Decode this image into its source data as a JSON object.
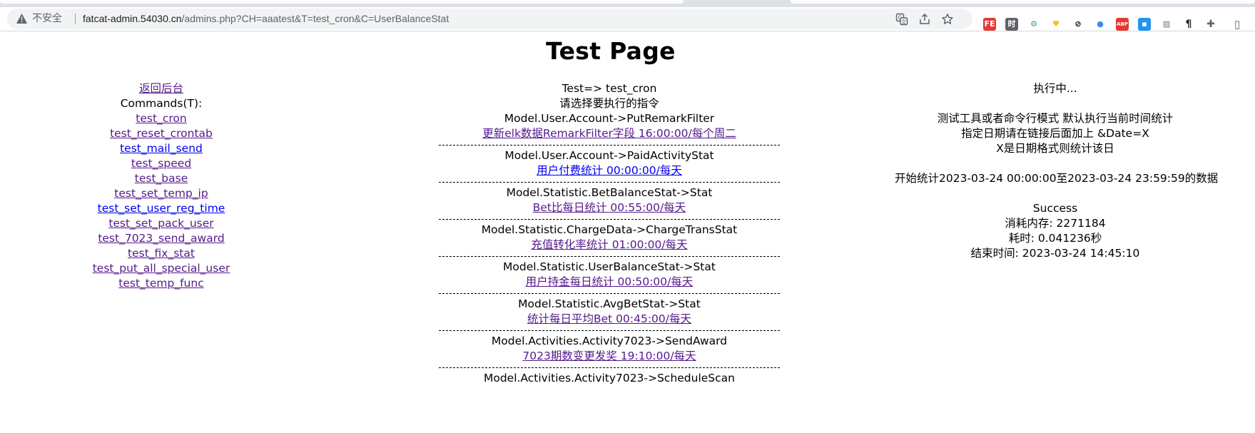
{
  "browser": {
    "security_label": "不安全",
    "url_host": "fatcat-admin.54030.cn",
    "url_path": "/admins.php?CH=aaatest&T=test_cron&C=UserBalanceStat",
    "extensions": [
      {
        "name": "fe-extension-icon",
        "label": "FE",
        "bg": "#e53935",
        "fg": "#ffffff"
      },
      {
        "name": "time-extension-icon",
        "label": "时",
        "bg": "#5f6368",
        "fg": "#ffffff"
      },
      {
        "name": "green-gear-extension-icon",
        "label": "⚙",
        "bg": "#ffffff",
        "fg": "#34a853"
      },
      {
        "name": "heart-extension-icon",
        "label": "♥",
        "bg": "#ffffff",
        "fg": "#fbbc04"
      },
      {
        "name": "block-extension-icon",
        "label": "⊘",
        "bg": "#ffffff",
        "fg": "#000000"
      },
      {
        "name": "blue-dot-extension-icon",
        "label": "●",
        "bg": "#ffffff",
        "fg": "#4285f4"
      },
      {
        "name": "adblock-extension-icon",
        "label": "ABP",
        "bg": "#e53935",
        "fg": "#ffffff"
      },
      {
        "name": "blue-square-extension-icon",
        "label": "▪",
        "bg": "#2196f3",
        "fg": "#ffffff"
      },
      {
        "name": "image-extension-icon",
        "label": "▨",
        "bg": "#ffffff",
        "fg": "#8d6e63"
      },
      {
        "name": "pilcrow-extension-icon",
        "label": "¶",
        "bg": "#ffffff",
        "fg": "#202124"
      },
      {
        "name": "puzzle-extensions-icon",
        "label": "✚",
        "bg": "#ffffff",
        "fg": "#5f6368"
      },
      {
        "name": "sidepanel-icon",
        "label": "▯",
        "bg": "#ffffff",
        "fg": "#5f6368"
      }
    ]
  },
  "page": {
    "title": "Test Page"
  },
  "left": {
    "back_link": "返回后台",
    "commands_label": "Commands(T):",
    "commands": [
      {
        "label": "test_cron",
        "visited": true
      },
      {
        "label": "test_reset_crontab",
        "visited": true
      },
      {
        "label": "test_mail_send",
        "visited": false
      },
      {
        "label": "test_speed",
        "visited": true
      },
      {
        "label": "test_base",
        "visited": true
      },
      {
        "label": "test_set_temp_ip",
        "visited": true
      },
      {
        "label": "test_set_user_reg_time",
        "visited": false
      },
      {
        "label": "test_set_pack_user",
        "visited": true
      },
      {
        "label": "test_7023_send_award",
        "visited": true
      },
      {
        "label": "test_fix_stat",
        "visited": true
      },
      {
        "label": "test_put_all_special_user",
        "visited": true
      },
      {
        "label": "test_temp_func",
        "visited": true
      }
    ]
  },
  "middle": {
    "header": "Test=> test_cron",
    "prompt": "请选择要执行的指令",
    "jobs": [
      {
        "model": "Model.User.Account->PutRemarkFilter",
        "link": "更新elk数据RemarkFilter字段 16:00:00/每个周二",
        "visited": true
      },
      {
        "model": "Model.User.Account->PaidActivityStat",
        "link": "用户付费统计 00:00:00/每天",
        "visited": false
      },
      {
        "model": "Model.Statistic.BetBalanceStat->Stat",
        "link": "Bet比每日统计 00:55:00/每天",
        "visited": true
      },
      {
        "model": "Model.Statistic.ChargeData->ChargeTransStat",
        "link": "充值转化率统计 01:00:00/每天",
        "visited": true
      },
      {
        "model": "Model.Statistic.UserBalanceStat->Stat",
        "link": "用户持金每日统计 00:50:00/每天",
        "visited": true
      },
      {
        "model": "Model.Statistic.AvgBetStat->Stat",
        "link": "统计每日平均Bet 00:45:00/每天",
        "visited": true
      },
      {
        "model": "Model.Activities.Activity7023->SendAward",
        "link": "7023期数变更发奖 19:10:00/每天",
        "visited": true
      },
      {
        "model": "Model.Activities.Activity7023->ScheduleScan",
        "link": "",
        "visited": true
      }
    ]
  },
  "right": {
    "status": "执行中...",
    "mode_note": "测试工具或者命令行模式 默认执行当前时间统计",
    "date_hint": "指定日期请在链接后面加上 &Date=X",
    "format_hint": "X是日期格式则统计该日",
    "start_note": "开始统计2023-03-24 00:00:00至2023-03-24 23:59:59的数据",
    "result": "Success",
    "memory": "消耗内存: 2271184",
    "elapsed": "耗时: 0.041236秒",
    "end_time": "结束时间: 2023-03-24 14:45:10"
  }
}
